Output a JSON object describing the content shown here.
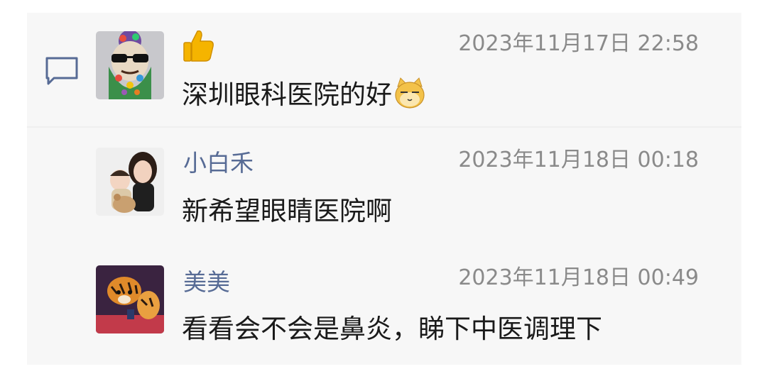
{
  "like_post": {
    "reaction_icon": "thumbs-up-icon",
    "timestamp": "2023年11月17日 22:58",
    "message": "深圳眼科医院的好",
    "emoji_icon": "cat-face-emoji-icon"
  },
  "replies": [
    {
      "name": "小白禾",
      "timestamp": "2023年11月18日 00:18",
      "message": "新希望眼睛医院啊"
    },
    {
      "name": "美美",
      "timestamp": "2023年11月18日 00:49",
      "message": "看看会不会是鼻炎，睇下中医调理下"
    }
  ],
  "colors": {
    "name_blue": "#576b95",
    "timestamp_gray": "#8a8a8a",
    "panel_bg": "#f7f7f7"
  }
}
